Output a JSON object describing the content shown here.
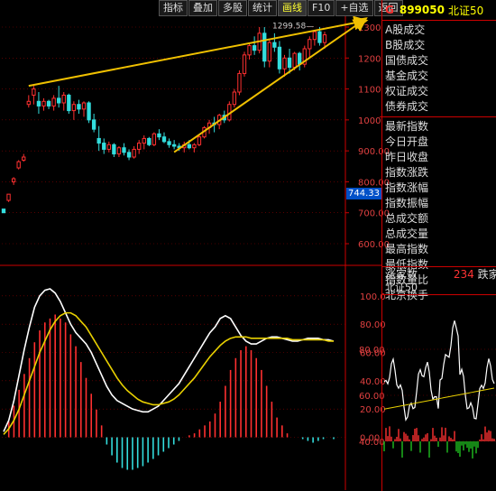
{
  "toolbar": {
    "buttons": [
      "指标",
      "叠加",
      "多股",
      "统计",
      "画线",
      "F10",
      "+自选",
      "返回"
    ],
    "active_index": 4
  },
  "stock": {
    "flag": "G",
    "code": "899050",
    "name": "北证50"
  },
  "side_menu": {
    "group1": [
      "A股成交",
      "B股成交",
      "国债成交",
      "基金成交",
      "权证成交",
      "债券成交"
    ],
    "group2": [
      "最新指数",
      "今日开盘",
      "昨日收盘",
      "指数涨跌",
      "指数涨幅",
      "指数振幅",
      "总成交额",
      "总成交量",
      "最高指数",
      "最低指数",
      "指数量比",
      "北京换手"
    ]
  },
  "mini_panel": {
    "label": "涨家数",
    "value": "234",
    "label2": "跌家数",
    "sub": "北证50"
  },
  "price_axis": {
    "ticks": [
      "1300",
      "1200",
      "1100",
      "1000",
      "900.00",
      "800.00",
      "700.00",
      "600.00"
    ],
    "current": "744.33",
    "high_label": "1299.58"
  },
  "macd_axis": {
    "ticks": [
      "100.0",
      "80.00",
      "60.00",
      "40.00",
      "20.00",
      "0.00"
    ]
  },
  "mini_axis": {
    "ticks": [
      "80.00",
      "60.00",
      "40.00"
    ]
  },
  "colors": {
    "up": "#ff3030",
    "down": "#33dddd",
    "trendline": "#f0c000",
    "dif": "#ffffff",
    "dea": "#e8d000",
    "grid": "#8b0000"
  },
  "chart_data": {
    "type": "candlestick",
    "title": "",
    "candles": [
      [
        712,
        712,
        700,
        700
      ],
      [
        740,
        760,
        735,
        760
      ],
      [
        800,
        815,
        790,
        810
      ],
      [
        845,
        870,
        840,
        865
      ],
      [
        870,
        890,
        865,
        880
      ],
      [
        1050,
        1080,
        1040,
        1060
      ],
      [
        1080,
        1110,
        1050,
        1100
      ],
      [
        1060,
        1090,
        1020,
        1045
      ],
      [
        1045,
        1070,
        1030,
        1060
      ],
      [
        1060,
        1065,
        1035,
        1045
      ],
      [
        1045,
        1080,
        1030,
        1070
      ],
      [
        1070,
        1110,
        1040,
        1055
      ],
      [
        1055,
        1090,
        1030,
        1080
      ],
      [
        1080,
        1085,
        1020,
        1030
      ],
      [
        1030,
        1060,
        1000,
        1050
      ],
      [
        1050,
        1065,
        1020,
        1035
      ],
      [
        1035,
        1060,
        1010,
        1055
      ],
      [
        1055,
        1060,
        990,
        1000
      ],
      [
        1000,
        1020,
        960,
        970
      ],
      [
        940,
        980,
        900,
        925
      ],
      [
        925,
        940,
        890,
        905
      ],
      [
        905,
        930,
        895,
        920
      ],
      [
        920,
        925,
        880,
        890
      ],
      [
        890,
        915,
        880,
        910
      ],
      [
        910,
        925,
        885,
        895
      ],
      [
        895,
        905,
        870,
        880
      ],
      [
        880,
        915,
        875,
        905
      ],
      [
        905,
        935,
        890,
        925
      ],
      [
        925,
        950,
        905,
        940
      ],
      [
        940,
        945,
        915,
        920
      ],
      [
        920,
        960,
        915,
        955
      ],
      [
        955,
        970,
        935,
        945
      ],
      [
        945,
        960,
        925,
        930
      ],
      [
        930,
        940,
        910,
        920
      ],
      [
        920,
        935,
        905,
        915
      ],
      [
        915,
        925,
        900,
        910
      ],
      [
        910,
        930,
        895,
        920
      ],
      [
        920,
        935,
        905,
        910
      ],
      [
        910,
        925,
        895,
        920
      ],
      [
        920,
        950,
        915,
        945
      ],
      [
        945,
        980,
        940,
        975
      ],
      [
        975,
        1000,
        955,
        990
      ],
      [
        990,
        1010,
        960,
        985
      ],
      [
        985,
        1020,
        970,
        1015
      ],
      [
        1015,
        1030,
        990,
        1000
      ],
      [
        1000,
        1060,
        995,
        1050
      ],
      [
        1050,
        1100,
        1040,
        1090
      ],
      [
        1090,
        1160,
        1080,
        1150
      ],
      [
        1150,
        1220,
        1140,
        1210
      ],
      [
        1210,
        1250,
        1195,
        1240
      ],
      [
        1240,
        1270,
        1210,
        1225
      ],
      [
        1225,
        1300,
        1215,
        1280
      ],
      [
        1280,
        1300,
        1170,
        1190
      ],
      [
        1190,
        1260,
        1170,
        1250
      ],
      [
        1250,
        1280,
        1220,
        1235
      ],
      [
        1235,
        1255,
        1150,
        1165
      ],
      [
        1165,
        1210,
        1140,
        1200
      ],
      [
        1200,
        1230,
        1150,
        1170
      ],
      [
        1170,
        1220,
        1160,
        1215
      ],
      [
        1215,
        1220,
        1160,
        1180
      ],
      [
        1180,
        1240,
        1170,
        1230
      ],
      [
        1230,
        1270,
        1200,
        1260
      ],
      [
        1260,
        1290,
        1240,
        1285
      ],
      [
        1285,
        1300,
        1240,
        1250
      ],
      [
        1250,
        1285,
        1230,
        1275
      ]
    ],
    "trendlines": [
      {
        "from": [
          5,
          1110
        ],
        "to": [
          72,
          1320
        ]
      },
      {
        "from": [
          34,
          896
        ],
        "to": [
          72,
          1325
        ]
      }
    ],
    "macd": {
      "hist": [
        0,
        8,
        16,
        24,
        32,
        40,
        48,
        54,
        58,
        60,
        62,
        60,
        58,
        52,
        46,
        38,
        30,
        22,
        14,
        6,
        -4,
        -10,
        -14,
        -17,
        -18,
        -18,
        -17,
        -16,
        -14,
        -12,
        -10,
        -8,
        -6,
        -4,
        -2,
        0,
        1,
        2,
        4,
        6,
        8,
        12,
        18,
        26,
        34,
        40,
        44,
        46,
        44,
        40,
        34,
        26,
        18,
        10,
        6,
        2,
        0,
        0,
        -1,
        -2,
        -3,
        -2,
        -1,
        0,
        -1
      ],
      "dif": [
        4,
        12,
        26,
        44,
        62,
        78,
        92,
        100,
        104,
        105,
        102,
        96,
        88,
        80,
        74,
        70,
        66,
        60,
        52,
        44,
        36,
        30,
        26,
        24,
        22,
        20,
        19,
        18,
        18,
        20,
        22,
        26,
        30,
        34,
        38,
        44,
        50,
        56,
        62,
        68,
        74,
        78,
        84,
        86,
        84,
        78,
        72,
        68,
        66,
        66,
        68,
        70,
        71,
        71,
        70,
        69,
        68,
        68,
        69,
        70,
        70,
        70,
        69,
        69,
        68
      ],
      "dea": [
        2,
        6,
        12,
        20,
        30,
        40,
        50,
        60,
        68,
        76,
        82,
        86,
        88,
        88,
        86,
        82,
        78,
        72,
        66,
        60,
        54,
        48,
        42,
        37,
        33,
        30,
        27,
        25,
        24,
        23,
        23,
        24,
        25,
        27,
        30,
        34,
        38,
        42,
        47,
        52,
        57,
        61,
        65,
        68,
        70,
        71,
        71,
        71,
        70,
        70,
        70,
        70,
        70,
        70,
        70,
        70,
        69,
        69,
        69,
        69,
        69,
        69,
        69,
        68,
        68
      ]
    }
  }
}
